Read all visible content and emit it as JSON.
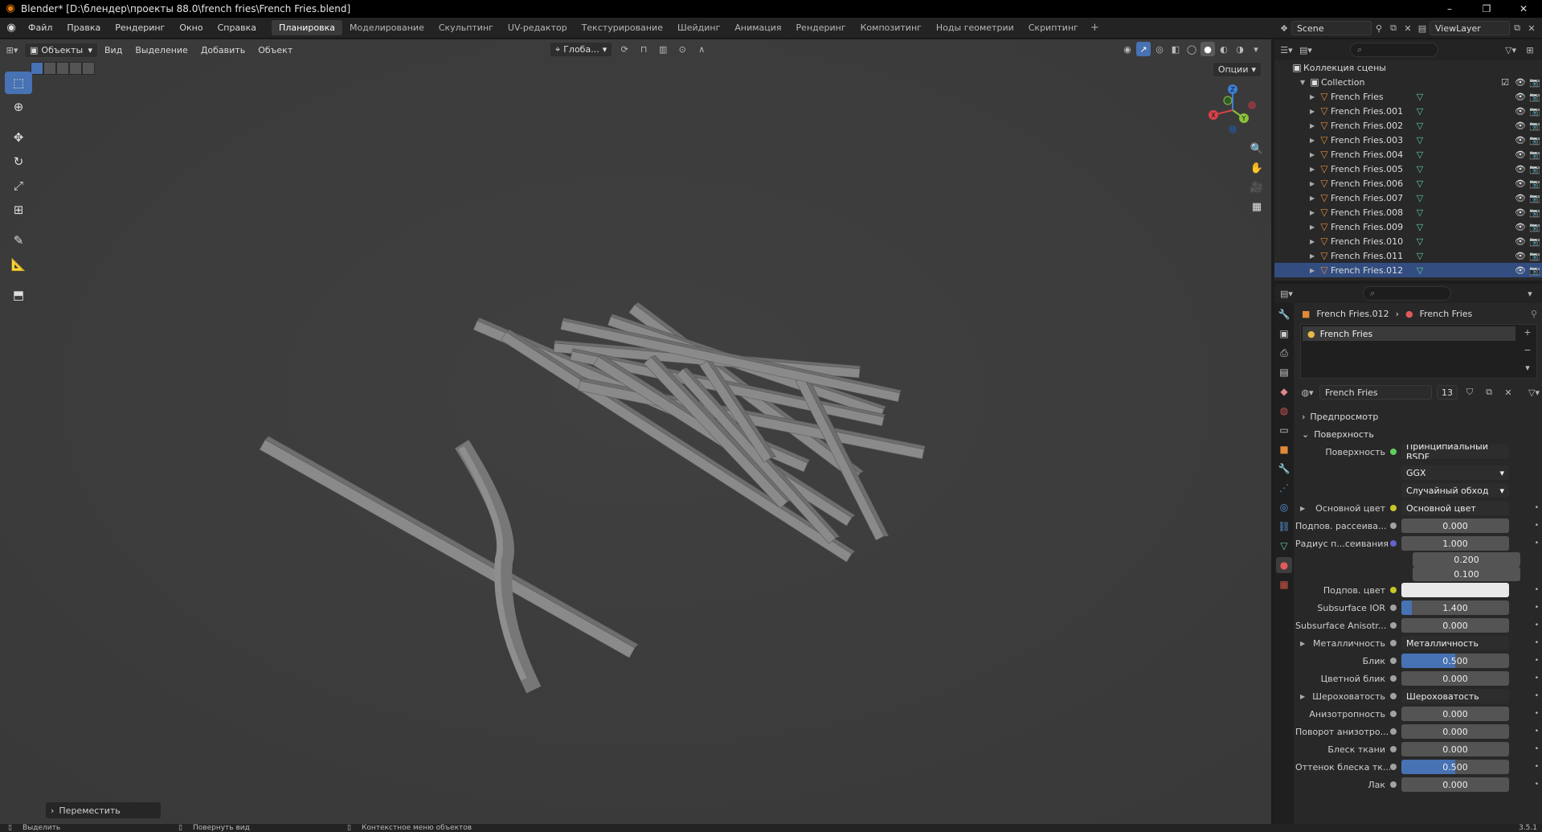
{
  "window": {
    "title": "Blender* [D:\\блендер\\проекты 88.0\\french fries\\French Fries.blend]",
    "controls": [
      "–",
      "❐",
      "✕"
    ]
  },
  "menu": [
    "Файл",
    "Правка",
    "Рендеринг",
    "Окно",
    "Справка"
  ],
  "workspaces": [
    "Планировка",
    "Моделирование",
    "Скульптинг",
    "UV-редактор",
    "Текстурирование",
    "Шейдинг",
    "Анимация",
    "Рендеринг",
    "Композитинг",
    "Ноды геометрии",
    "Скриптинг"
  ],
  "active_workspace": "Планировка",
  "scene": {
    "name": "Scene",
    "view_layer": "ViewLayer"
  },
  "viewport": {
    "mode": "Объекты",
    "menu": [
      "Вид",
      "Выделение",
      "Добавить",
      "Объект"
    ],
    "orientation": "Глоба...",
    "options": "Опции",
    "last_operator": "Переместить",
    "gizmo_labels": {
      "z": "Z",
      "y": "Y",
      "x": "X"
    }
  },
  "outliner": {
    "scene_collection": "Коллекция сцены",
    "collection": "Collection",
    "objects": [
      "French Fries",
      "French Fries.001",
      "French Fries.002",
      "French Fries.003",
      "French Fries.004",
      "French Fries.005",
      "French Fries.006",
      "French Fries.007",
      "French Fries.008",
      "French Fries.009",
      "French Fries.010",
      "French Fries.011",
      "French Fries.012"
    ],
    "selected_index": 12
  },
  "properties": {
    "breadcrumb_object": "French Fries.012",
    "breadcrumb_material": "French Fries",
    "slot_name": "French Fries",
    "material_name": "French Fries",
    "user_count": "13",
    "panel_preview": "Предпросмотр",
    "panel_surface": "Поверхность",
    "surface_label": "Поверхность",
    "surface_value": "Принципиальный BSDF",
    "distribution": "GGX",
    "subsurface_method": "Случайный обход",
    "rows": [
      {
        "label": "Основной цвет",
        "value": "Основной цвет",
        "kind": "link",
        "sock": "yellow",
        "expand": true
      },
      {
        "label": "Подпов. рассеива...",
        "value": "0.000",
        "kind": "num",
        "sock": "grey",
        "fill": 0
      },
      {
        "label": "Радиус п...сеивания",
        "value": "1.000",
        "kind": "num",
        "sock": "blue",
        "fill": 0
      },
      {
        "label": "",
        "value": "0.200",
        "kind": "num",
        "sock": "none",
        "fill": 0,
        "sub": true
      },
      {
        "label": "",
        "value": "0.100",
        "kind": "num",
        "sock": "none",
        "fill": 0,
        "sub": true
      },
      {
        "label": "Подпов. цвет",
        "value": "",
        "kind": "white",
        "sock": "yellow"
      },
      {
        "label": "Subsurface IOR",
        "value": "1.400",
        "kind": "num",
        "sock": "grey",
        "fill": 0.1
      },
      {
        "label": "Subsurface Anisotr...",
        "value": "0.000",
        "kind": "num",
        "sock": "grey",
        "fill": 0
      },
      {
        "label": "Металличность",
        "value": "Металличность",
        "kind": "link",
        "sock": "grey",
        "expand": true
      },
      {
        "label": "Блик",
        "value": "0.500",
        "kind": "num",
        "sock": "grey",
        "fill": 0.5
      },
      {
        "label": "Цветной блик",
        "value": "0.000",
        "kind": "num",
        "sock": "grey",
        "fill": 0
      },
      {
        "label": "Шероховатость",
        "value": "Шероховатость",
        "kind": "link",
        "sock": "grey",
        "expand": true
      },
      {
        "label": "Анизотропность",
        "value": "0.000",
        "kind": "num",
        "sock": "grey",
        "fill": 0
      },
      {
        "label": "Поворот анизотро...",
        "value": "0.000",
        "kind": "num",
        "sock": "grey",
        "fill": 0
      },
      {
        "label": "Блеск ткани",
        "value": "0.000",
        "kind": "num",
        "sock": "grey",
        "fill": 0
      },
      {
        "label": "Оттенок блеска тк...",
        "value": "0.500",
        "kind": "num",
        "sock": "grey",
        "fill": 0.5
      },
      {
        "label": "Лак",
        "value": "0.000",
        "kind": "num",
        "sock": "grey",
        "fill": 0
      }
    ]
  },
  "statusbar": {
    "left": "Выделить",
    "middle": "Повернуть вид",
    "right": "Контекстное меню объектов",
    "version": "3.5.1"
  },
  "colors": {
    "accent": "#4772b3",
    "selected_row": "#334d80",
    "mesh": "#e08a3a",
    "data": "#5fcf9a"
  }
}
